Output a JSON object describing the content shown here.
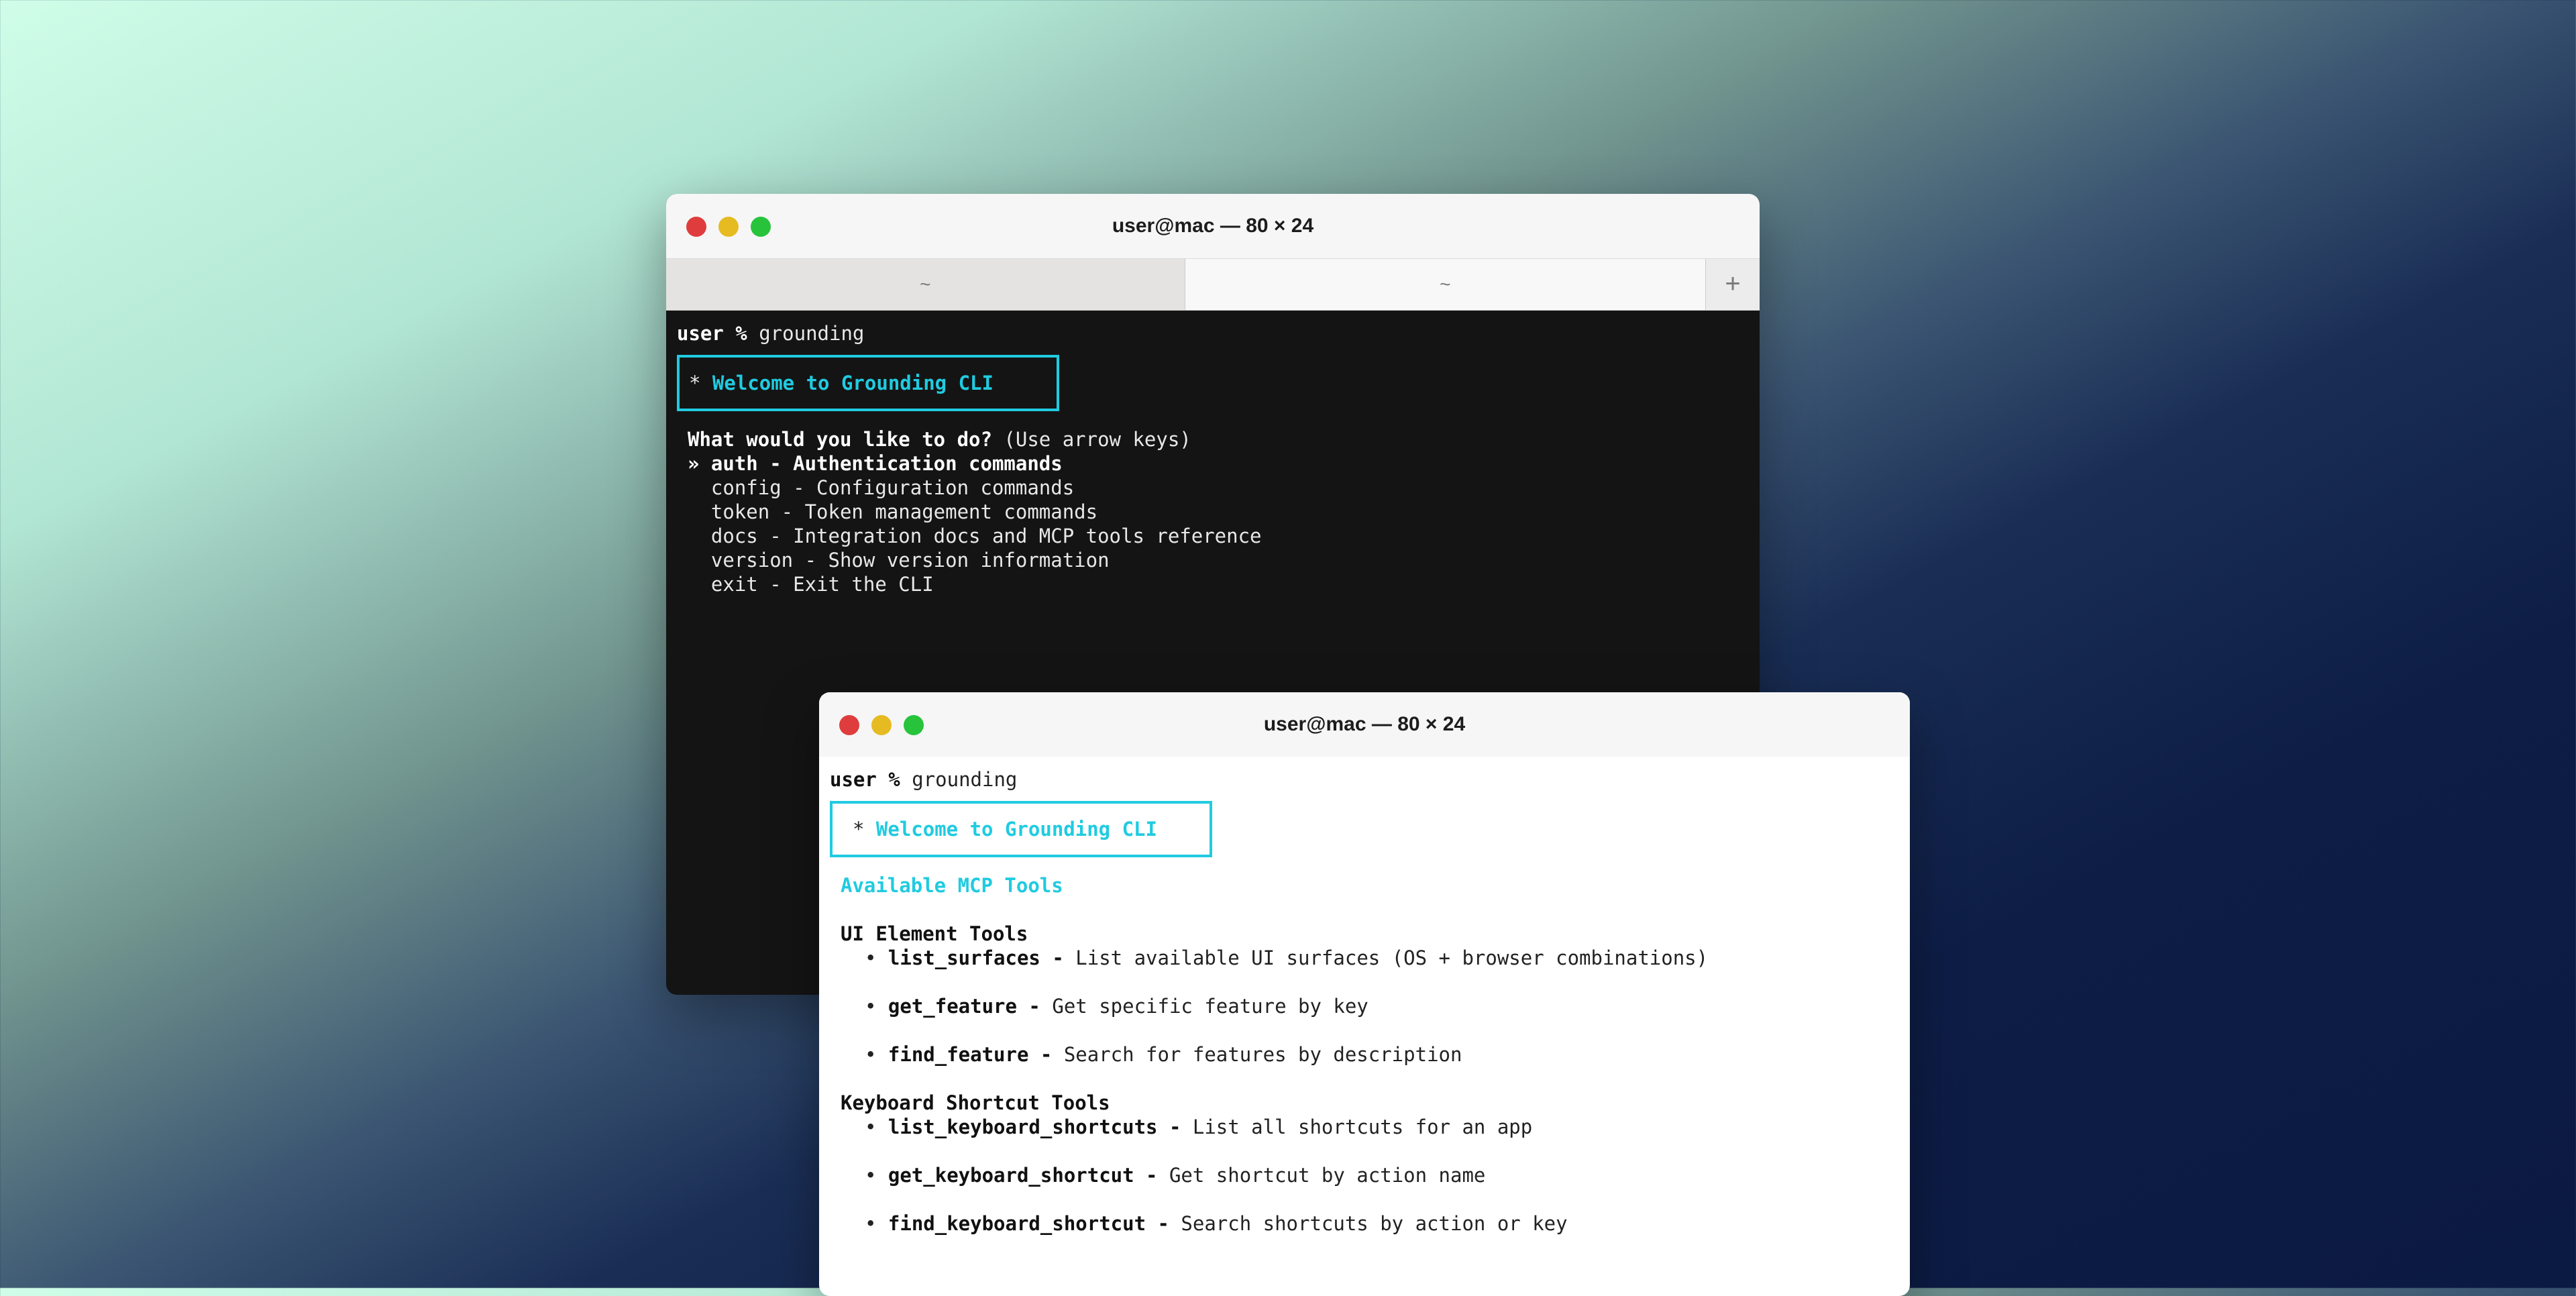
{
  "back_window": {
    "title": "user@mac — 80 × 24",
    "tabs": [
      {
        "label": "~"
      },
      {
        "label": "~"
      }
    ],
    "new_tab_label": "+",
    "prompt_user": "user %",
    "command": " grounding",
    "welcome_star": "* ",
    "welcome_text": "Welcome to Grounding CLI",
    "question": "What would you like to do?",
    "question_hint": " (Use arrow keys)",
    "selected_marker": "» ",
    "menu": [
      {
        "label": "auth - Authentication commands"
      },
      {
        "label": "config - Configuration commands"
      },
      {
        "label": "token - Token management commands"
      },
      {
        "label": "docs - Integration docs and MCP tools reference"
      },
      {
        "label": "version - Show version information"
      },
      {
        "label": "exit - Exit the CLI"
      }
    ]
  },
  "front_window": {
    "title": "user@mac — 80 × 24",
    "prompt_user": "user %",
    "command": " grounding",
    "welcome_star": "* ",
    "welcome_text": "Welcome to Grounding CLI",
    "section_title": "Available MCP Tools",
    "groups": [
      {
        "title": "UI Element Tools",
        "tools": [
          {
            "name": "list_surfaces -",
            "desc": " List available UI surfaces (OS + browser combinations)"
          },
          {
            "name": "get_feature -",
            "desc": " Get specific feature by key"
          },
          {
            "name": "find_feature -",
            "desc": " Search for features by description"
          }
        ]
      },
      {
        "title": "Keyboard Shortcut Tools",
        "tools": [
          {
            "name": "list_keyboard_shortcuts -",
            "desc": " List all shortcuts for an app"
          },
          {
            "name": "get_keyboard_shortcut -",
            "desc": " Get shortcut by action name"
          },
          {
            "name": "find_keyboard_shortcut -",
            "desc": " Search shortcuts by action or key"
          }
        ]
      }
    ],
    "bullet": "• "
  }
}
